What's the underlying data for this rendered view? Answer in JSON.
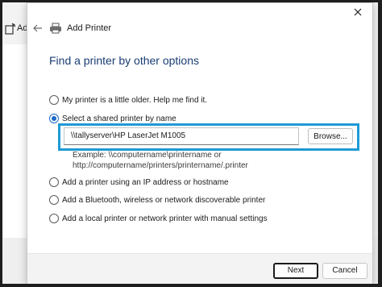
{
  "background_window": {
    "label": "Ad"
  },
  "dialog": {
    "title": "Add Printer",
    "heading": "Find a printer by other options",
    "options": [
      {
        "label": "My printer is a little older. Help me find it.",
        "selected": false
      },
      {
        "label": "Select a shared printer by name",
        "selected": true
      },
      {
        "label": "Add a printer using an IP address or hostname",
        "selected": false
      },
      {
        "label": "Add a Bluetooth, wireless or network discoverable printer",
        "selected": false
      },
      {
        "label": "Add a local printer or network printer with manual settings",
        "selected": false
      }
    ],
    "shared_printer_value": "\\\\tallyserver\\HP LaserJet M1005",
    "browse_label": "Browse...",
    "example_line1": "Example: \\\\computername\\printername or",
    "example_line2": "http://computername/printers/printername/.printer",
    "next_label": "Next",
    "cancel_label": "Cancel"
  },
  "colors": {
    "accent": "#1b6ac9",
    "highlight_box": "#1e9ad6",
    "heading": "#1a3d74"
  },
  "icons": [
    "printer-icon",
    "back-arrow-icon",
    "close-icon"
  ]
}
